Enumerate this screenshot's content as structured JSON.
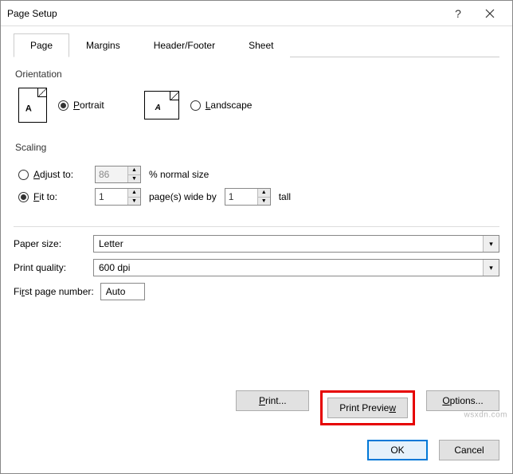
{
  "title": "Page Setup",
  "tabs": [
    "Page",
    "Margins",
    "Header/Footer",
    "Sheet"
  ],
  "activeTab": 0,
  "orientation": {
    "label": "Orientation",
    "portrait": "Portrait",
    "landscape": "Landscape",
    "selected": "portrait"
  },
  "scaling": {
    "label": "Scaling",
    "adjust_to": "Adjust to:",
    "adjust_value": "86",
    "adjust_suffix": "% normal size",
    "fit_to": "Fit to:",
    "fit_wide_value": "1",
    "fit_wide_suffix": "page(s) wide by",
    "fit_tall_value": "1",
    "fit_tall_suffix": "tall",
    "selected": "fit"
  },
  "paper_size": {
    "label": "Paper size:",
    "value": "Letter"
  },
  "print_quality": {
    "label": "Print quality:",
    "value": "600 dpi"
  },
  "first_page": {
    "label": "First page number:",
    "value": "Auto"
  },
  "buttons": {
    "print": "Print...",
    "preview": "Print Preview",
    "options": "Options...",
    "ok": "OK",
    "cancel": "Cancel"
  },
  "watermark": "wsxdn.com"
}
